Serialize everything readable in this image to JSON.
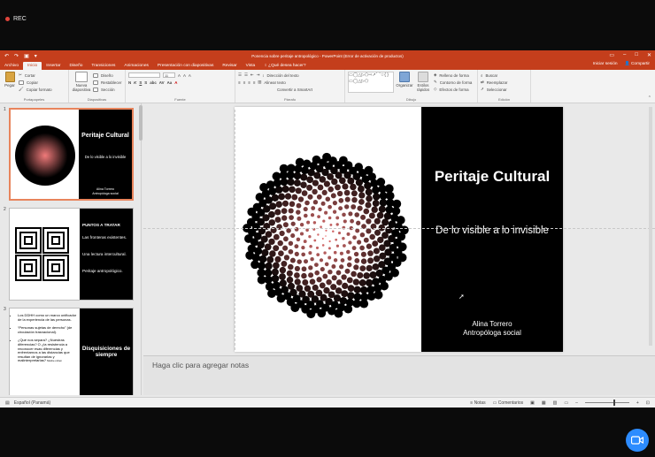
{
  "recording": {
    "label": "REC"
  },
  "window": {
    "title": "Ponencia sobre peritaje antropológico - PowerPoint (Error de activación de productos)"
  },
  "tabs": [
    "Archivo",
    "Inicio",
    "Insertar",
    "Diseño",
    "Transiciones",
    "Animaciones",
    "Presentación con diapositivas",
    "Revisar",
    "Vista"
  ],
  "tell_me": "¿Qué desea hacer?",
  "signin": "Iniciar sesión",
  "share": "Compartir",
  "ribbon": {
    "groups": [
      "Portapapeles",
      "Diapositivas",
      "Fuente",
      "Párrafo",
      "Dibujo",
      "Edición"
    ],
    "paste": "Pegar",
    "cut": "Cortar",
    "copy": "Copiar",
    "format_painter": "Copiar formato",
    "new_slide": "Nueva diapositiva",
    "layout": "Diseño",
    "reset": "Restablecer",
    "section": "Sección",
    "font_size": "11",
    "text_direction": "Dirección del texto",
    "align_text": "Alinear texto",
    "smartart": "Convertir a SmartArt",
    "arrange": "Organizar",
    "quick_styles": "Estilos rápidos",
    "shape_fill": "Relleno de forma",
    "shape_outline": "Contorno de forma",
    "shape_effects": "Efectos de forma",
    "find": "Buscar",
    "replace": "Reemplazar",
    "select": "Seleccionar"
  },
  "thumbnails": [
    {
      "num": "1",
      "title": "Peritaje Cultural",
      "subtitle": "De lo visible a lo invisible",
      "author": "Alina Torrero",
      "role": "Antropóloga social"
    },
    {
      "num": "2",
      "heading": "PUNTOS A TRATAR",
      "lines": [
        "Las fronteras existentes.",
        "Una lectura intercultural.",
        "Peritaje antropológico."
      ]
    },
    {
      "num": "3",
      "bullets": [
        "Los DDHH como un marco unificador de la experiencia de las personas.",
        "“Personas sujetas de derecho” (de circulación trasnacional).",
        "¿Qué nos separa? ¿Nuestras diferencias? O ¿la resistencia a reconocer esas diferencias y enfrentarnos a las distancias que resultan de ignorarlas y malinterpretarlas?"
      ],
      "small_note": "Moshe cohen",
      "title": "Disquisiciones de siempre"
    }
  ],
  "slide": {
    "title": "Peritaje Cultural",
    "subtitle": "De lo visible a lo invisible",
    "author": "Alina Torrero",
    "role": "Antropóloga social"
  },
  "notes_placeholder": "Haga clic para agregar notas",
  "statusbar": {
    "language": "Español (Panamá)",
    "notes": "Notas",
    "comments": "Comentarios"
  },
  "colors": {
    "accent": "#c43e1c",
    "dot_center": "#f07a7a",
    "dot_outer": "#000000",
    "selected_border": "#e8845c",
    "camera_button": "#2d8cff"
  }
}
